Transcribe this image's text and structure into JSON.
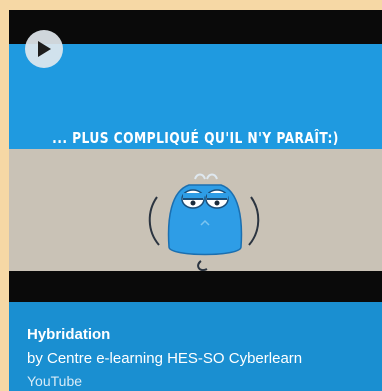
{
  "card": {
    "video": {
      "caption": "... PLUS COMPLIQUÉ QU'IL N'Y PARAÎT:)"
    },
    "title": "Hybridation",
    "byline": "by Centre e-learning HES-SO Cyberlearn",
    "source": "YouTube"
  },
  "icons": {
    "play": "play-icon"
  },
  "colors": {
    "page_background": "#f6d8a5",
    "card_background": "#1a8fd1",
    "video_blue": "#1f9ae0",
    "floor": "#c9c2b6",
    "letterbox": "#0a0a0a"
  }
}
